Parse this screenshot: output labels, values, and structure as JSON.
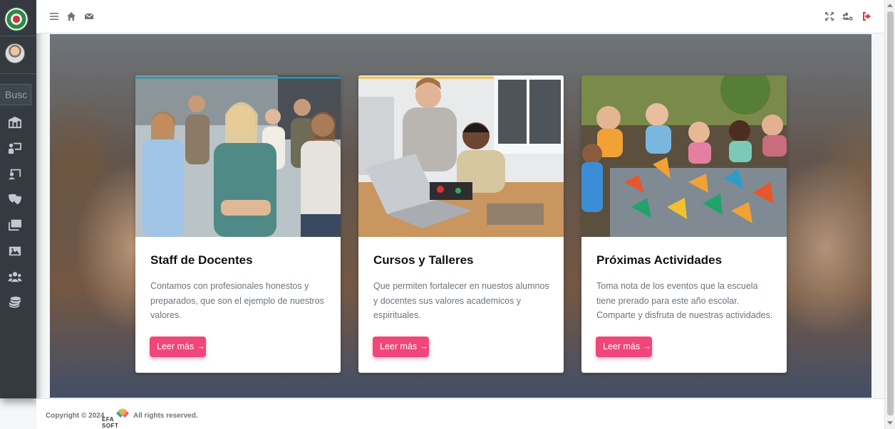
{
  "sidebar": {
    "search_placeholder": "Busc",
    "items": [
      {
        "icon": "school-icon"
      },
      {
        "icon": "chalkboard-teacher-icon"
      },
      {
        "icon": "chalkboard-icon"
      },
      {
        "icon": "theater-masks-icon"
      },
      {
        "icon": "photo-gallery-icon"
      },
      {
        "icon": "image-icon"
      },
      {
        "icon": "users-icon"
      },
      {
        "icon": "coins-icon"
      }
    ]
  },
  "topbar": {
    "left_icons": [
      "menu-icon",
      "home-icon",
      "envelope-icon"
    ],
    "right_icons": [
      "fullscreen-icon",
      "users-cog-icon",
      "logout-icon"
    ]
  },
  "cards": [
    {
      "title": "Staff de Docentes",
      "text": "Contamos con profesionales honestos y preparados, que son el ejemplo de nuestros valores.",
      "button": "Leer más",
      "accent": "#17a2b8"
    },
    {
      "title": "Cursos y Talleres",
      "text": "Que permiten fortalecer en nuestos alumnos y docentes sus valores academicos y espirituales.",
      "button": "Leer más",
      "accent": "#ffc107"
    },
    {
      "title": "Próximas Actividades",
      "text": "Toma nota de los eventos que la escuela tiene prerado para este año escolar. Comparte y disfruta de nuestras actividades.",
      "button": "Leer más",
      "accent": "#ffc107"
    }
  ],
  "footer": {
    "copyright": "Copyright © 2024",
    "logo_text": "EFA SOFT",
    "rights": "All rights reserved."
  },
  "colors": {
    "sidebar_bg": "#343a40",
    "button_pink": "#f0467c"
  }
}
